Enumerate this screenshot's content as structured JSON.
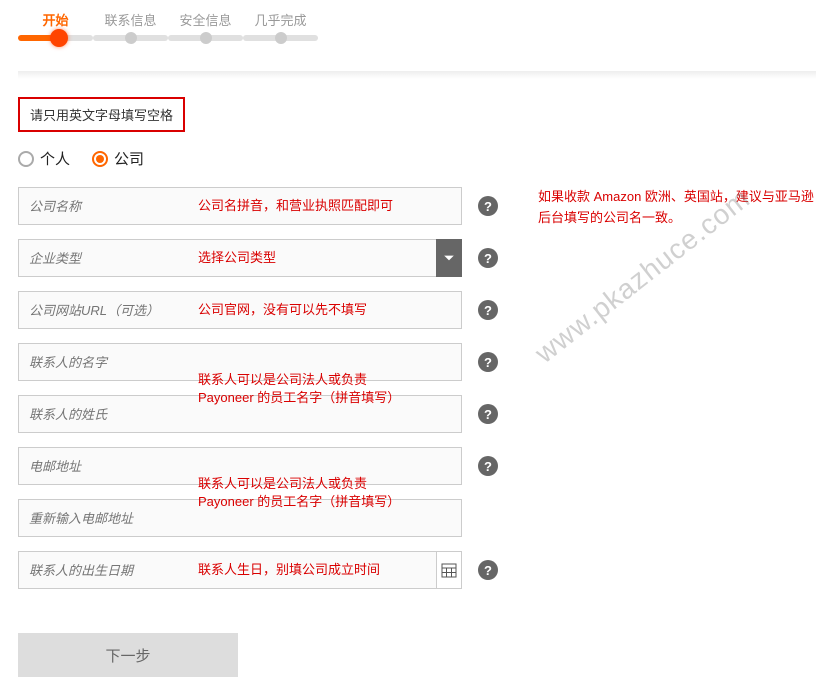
{
  "steps": {
    "s1": "开始",
    "s2": "联系信息",
    "s3": "安全信息",
    "s4": "几乎完成"
  },
  "warning": "请只用英文字母填写空格",
  "radio": {
    "personal": "个人",
    "company": "公司"
  },
  "fields": {
    "company_name": "公司名称",
    "company_type": "企业类型",
    "website": "公司网站URL（可选）",
    "contact_first": "联系人的名字",
    "contact_last": "联系人的姓氏",
    "email": "电邮地址",
    "email_confirm": "重新输入电邮地址",
    "dob": "联系人的出生日期"
  },
  "annotations": {
    "company_name": "公司名拼音，和营业执照匹配即可",
    "company_type": "选择公司类型",
    "website": "公司官网，没有可以先不填写",
    "contact_block": "联系人可以是公司法人或负责\nPayoneer 的员工名字（拼音填写）",
    "email_block": "联系人可以是公司法人或负责\nPayoneer 的员工名字（拼音填写）",
    "dob": "联系人生日，别填公司成立时间",
    "side": "如果收款 Amazon 欧洲、英国站，建议与亚马逊后台填写的公司名一致。"
  },
  "help_char": "?",
  "next_button": "下一步",
  "watermark": "www.pkazhuce.com"
}
